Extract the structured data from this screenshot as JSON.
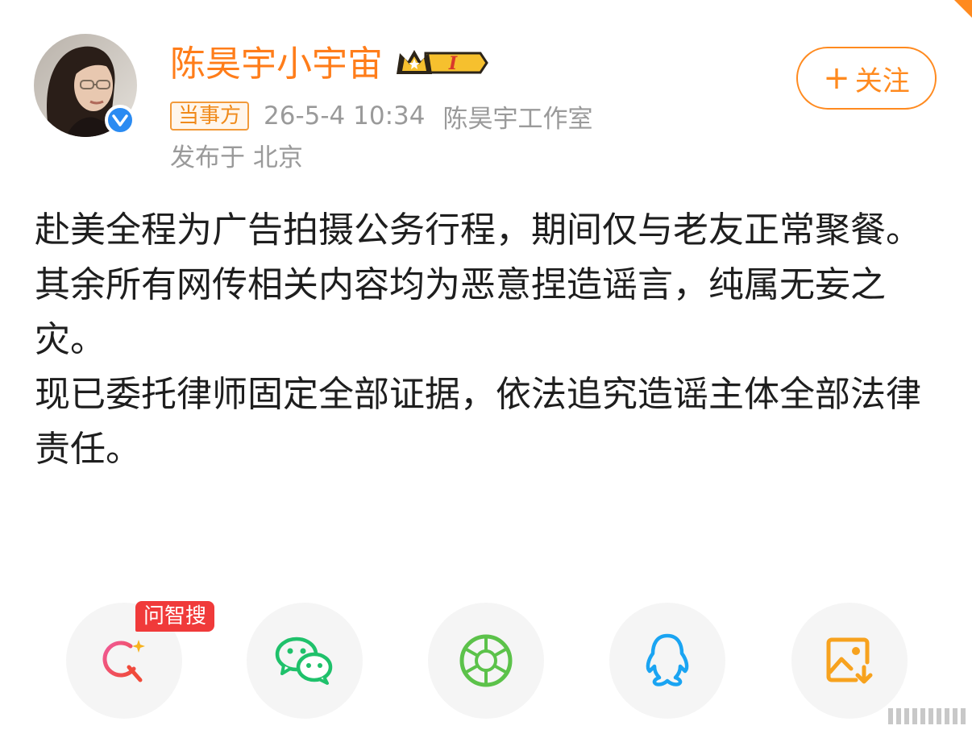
{
  "post": {
    "username": "陈昊宇小宇宙",
    "vip_badge_text": "I",
    "follow_label": "关注",
    "party_tag": "当事方",
    "timestamp": "26-5-4 10:34",
    "source": "陈昊宇工作室",
    "location": "发布于 北京",
    "content_paragraphs": [
      "赴美全程为广告拍摄公务行程，期间仅与老友正常聚餐。",
      "其余所有网传相关内容均为恶意捏造谣言，纯属无妄之灾。",
      "现已委托律师固定全部证据，依法追究造谣主体全部法律责任。"
    ]
  },
  "share": {
    "ai_tag": "问智搜",
    "items": [
      {
        "name": "ai-search",
        "icon": "sparkle-search-icon"
      },
      {
        "name": "wechat",
        "icon": "wechat-icon"
      },
      {
        "name": "moments",
        "icon": "aperture-icon"
      },
      {
        "name": "qq",
        "icon": "qq-penguin-icon"
      },
      {
        "name": "save-image",
        "icon": "save-image-icon"
      }
    ]
  },
  "colors": {
    "accent": "#ff8a1f",
    "username": "#ff7d1a",
    "meta": "#9a9a9a",
    "text": "#1e1e1e",
    "verified": "#2a8bf2",
    "ai_tag": "#f03a3a",
    "wechat": "#1fc16b",
    "moments": "#5cc24a",
    "qq": "#1aa4f2"
  }
}
